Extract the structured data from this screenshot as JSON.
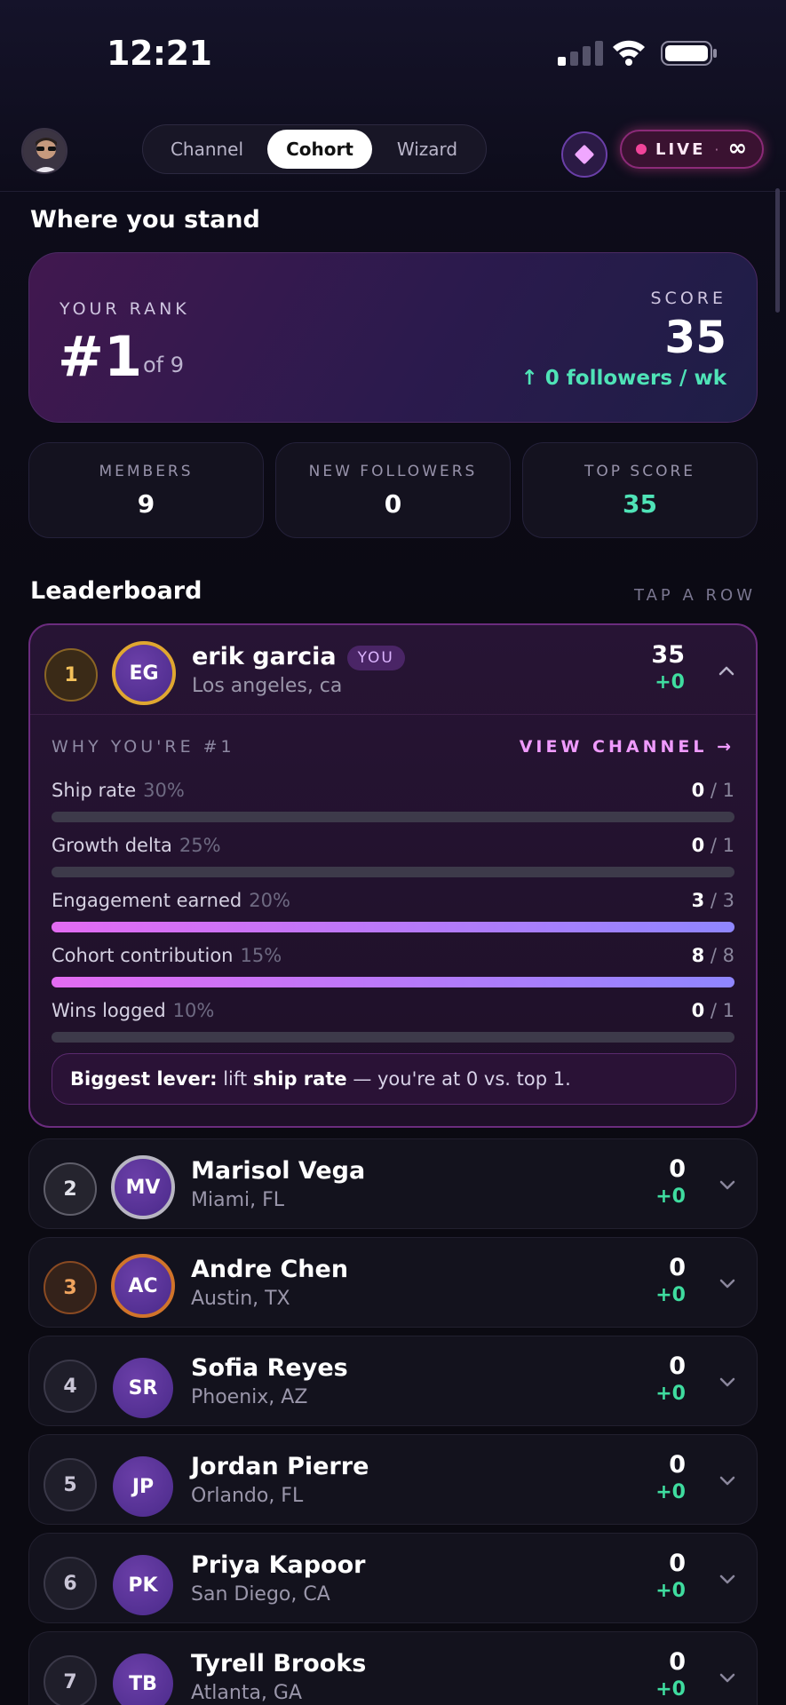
{
  "status_bar": {
    "time": "12:21"
  },
  "header": {
    "tabs": [
      {
        "label": "Channel"
      },
      {
        "label": "Cohort"
      },
      {
        "label": "Wizard"
      }
    ],
    "active_tab": "Cohort",
    "live_label": "LIVE",
    "live_separator": "·",
    "live_value": "∞"
  },
  "standing": {
    "title": "Where you stand",
    "rank_label": "YOUR RANK",
    "rank": "#1",
    "rank_of": "of 9",
    "score_label": "SCORE",
    "score": "35",
    "followers_rate": "↑ 0 followers / wk"
  },
  "stats": [
    {
      "label": "MEMBERS",
      "value": "9"
    },
    {
      "label": "NEW FOLLOWERS",
      "value": "0"
    },
    {
      "label": "TOP SCORE",
      "value": "35"
    }
  ],
  "leaderboard": {
    "title": "Leaderboard",
    "hint": "TAP A ROW",
    "you_badge": "YOU",
    "rows": [
      {
        "rank": "1",
        "initials": "EG",
        "name": "erik garcia",
        "city": "Los angeles, ca",
        "score": "35",
        "delta": "+0"
      },
      {
        "rank": "2",
        "initials": "MV",
        "name": "Marisol Vega",
        "city": "Miami, FL",
        "score": "0",
        "delta": "+0"
      },
      {
        "rank": "3",
        "initials": "AC",
        "name": "Andre Chen",
        "city": "Austin, TX",
        "score": "0",
        "delta": "+0"
      },
      {
        "rank": "4",
        "initials": "SR",
        "name": "Sofia Reyes",
        "city": "Phoenix, AZ",
        "score": "0",
        "delta": "+0"
      },
      {
        "rank": "5",
        "initials": "JP",
        "name": "Jordan Pierre",
        "city": "Orlando, FL",
        "score": "0",
        "delta": "+0"
      },
      {
        "rank": "6",
        "initials": "PK",
        "name": "Priya Kapoor",
        "city": "San Diego, CA",
        "score": "0",
        "delta": "+0"
      },
      {
        "rank": "7",
        "initials": "TB",
        "name": "Tyrell Brooks",
        "city": "Atlanta, GA",
        "score": "0",
        "delta": "+0"
      }
    ],
    "expanded": {
      "why_label": "WHY YOU'RE #1",
      "view_channel": "VIEW CHANNEL →",
      "metrics": [
        {
          "name": "Ship rate",
          "weight": "30%",
          "value": "0",
          "max": "/ 1",
          "progress": 0
        },
        {
          "name": "Growth delta",
          "weight": "25%",
          "value": "0",
          "max": "/ 1",
          "progress": 0
        },
        {
          "name": "Engagement earned",
          "weight": "20%",
          "value": "3",
          "max": "/ 3",
          "progress": 1
        },
        {
          "name": "Cohort contribution",
          "weight": "15%",
          "value": "8",
          "max": "/ 8",
          "progress": 1
        },
        {
          "name": "Wins logged",
          "weight": "10%",
          "value": "0",
          "max": "/ 1",
          "progress": 0
        }
      ],
      "lever_prefix": "Biggest lever:",
      "lever_mid": "lift",
      "lever_metric": "ship rate",
      "lever_suffix": "— you're at 0 vs. top 1."
    }
  },
  "colors": {
    "accent": "#f09bff",
    "positive": "#3fdc9f",
    "live": "#f0449a"
  }
}
